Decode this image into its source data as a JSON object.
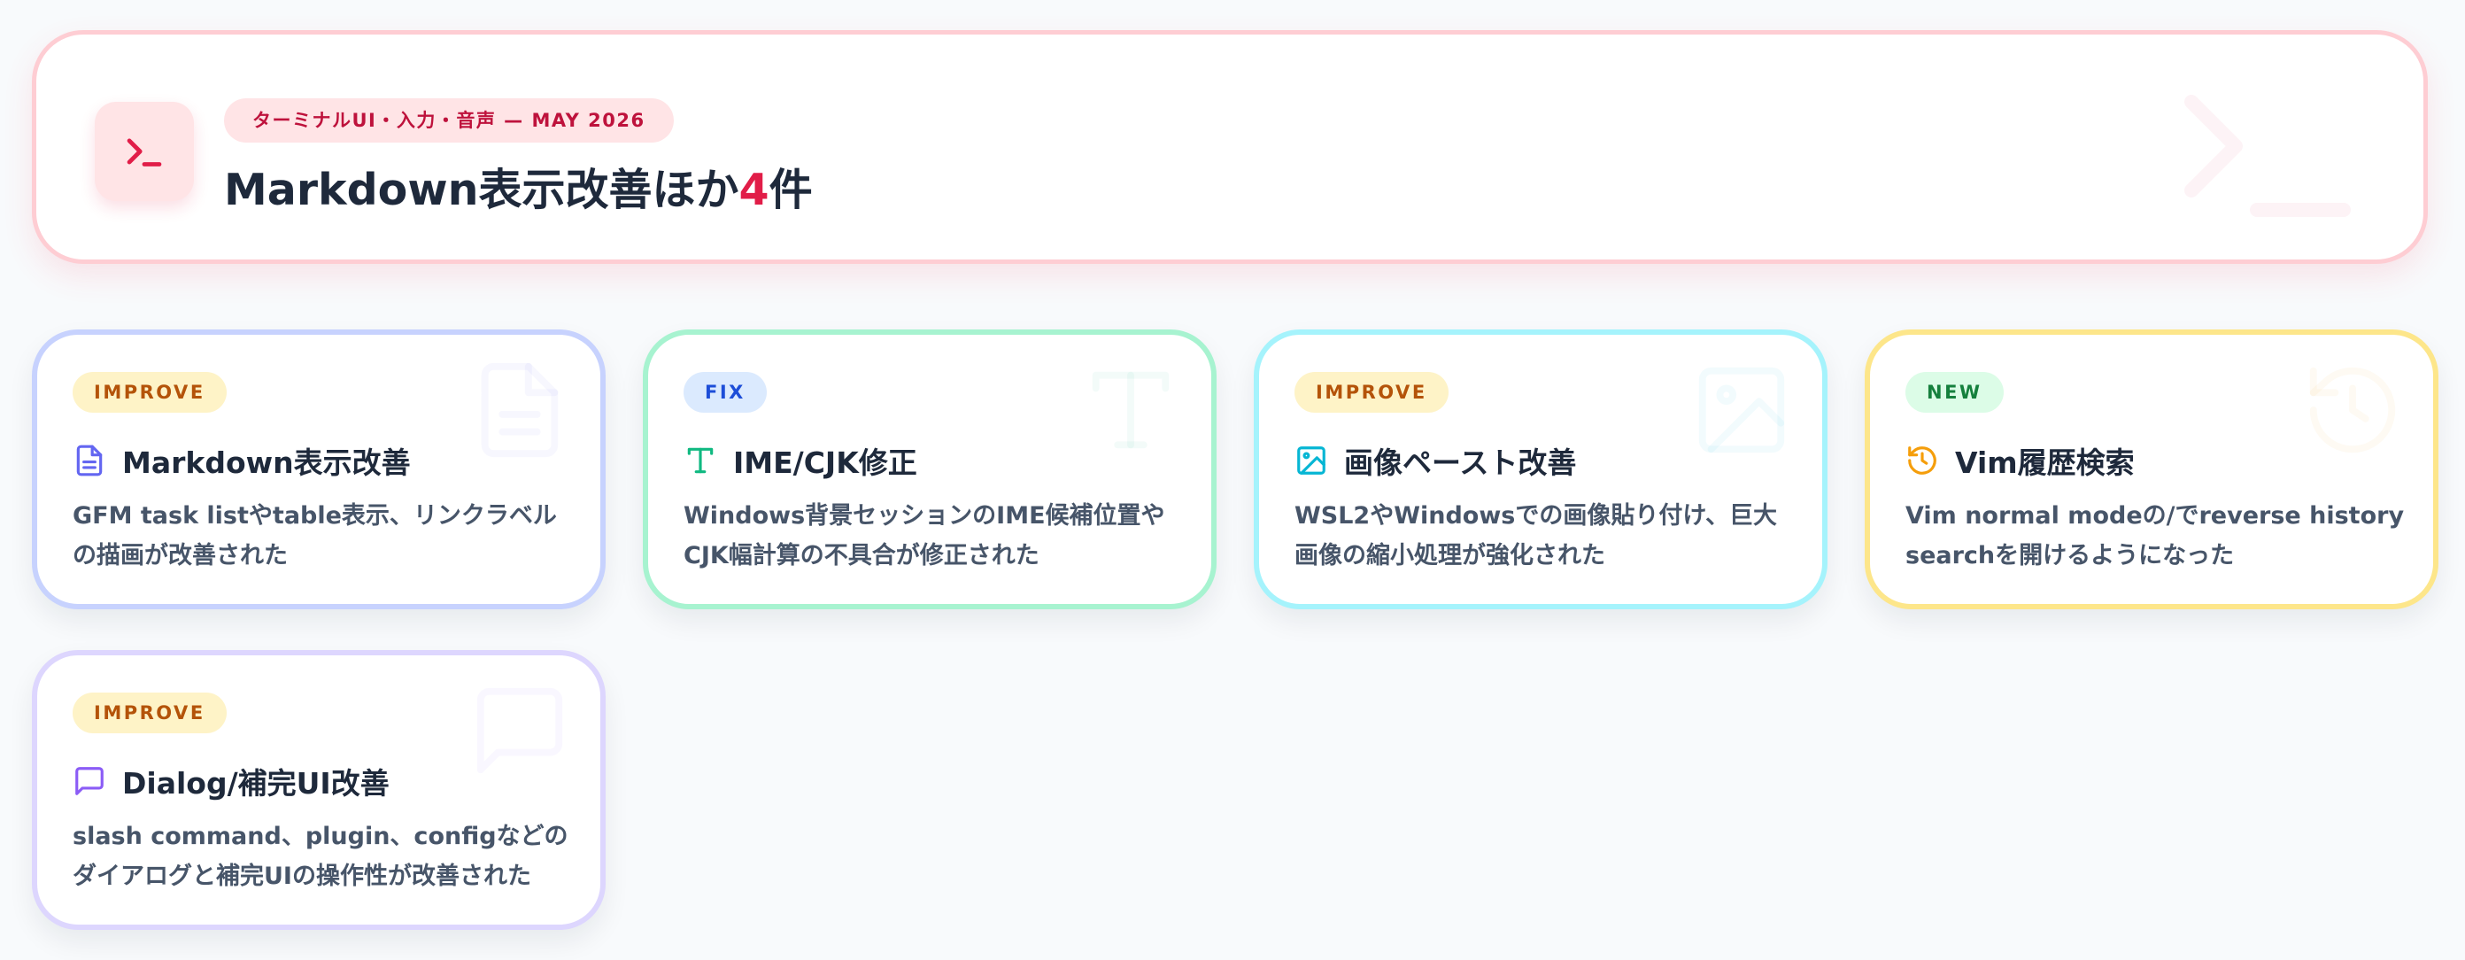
{
  "header": {
    "icon": "terminal-prompt-icon",
    "pill_label": "ターミナルUI・入力・音声 — MAY 2026",
    "title_main": "Markdown表示改善ほか",
    "title_count": "4",
    "title_suffix": "件",
    "accent_color": "#e11d48"
  },
  "cards": [
    {
      "badge": "IMPROVE",
      "icon": "document-icon",
      "title": "Markdown表示改善",
      "description": "GFM task listやtable表示、リンクラベルの描画が改善された",
      "border_color": "#c7d2fe",
      "icon_color": "#6366f1"
    },
    {
      "badge": "FIX",
      "icon": "text-type-icon",
      "title": "IME/CJK修正",
      "description": "Windows背景セッションのIME候補位置やCJK幅計算の不具合が修正された",
      "border_color": "#a7f3d0",
      "icon_color": "#10b981"
    },
    {
      "badge": "IMPROVE",
      "icon": "image-icon",
      "title": "画像ペースト改善",
      "description": "WSL2やWindowsでの画像貼り付け、巨大画像の縮小処理が強化された",
      "border_color": "#a5f3fc",
      "icon_color": "#06b6d4"
    },
    {
      "badge": "NEW",
      "icon": "history-icon",
      "title": "Vim履歴検索",
      "description": "Vim normal modeの/でreverse history searchを開けるようになった",
      "border_color": "#fde68a",
      "icon_color": "#f59e0b"
    },
    {
      "badge": "IMPROVE",
      "icon": "chat-bubble-icon",
      "title": "Dialog/補完UI改善",
      "description": "slash command、plugin、configなどのダイアログと補完UIの操作性が改善された",
      "border_color": "#ddd6fe",
      "icon_color": "#8b5cf6"
    }
  ]
}
